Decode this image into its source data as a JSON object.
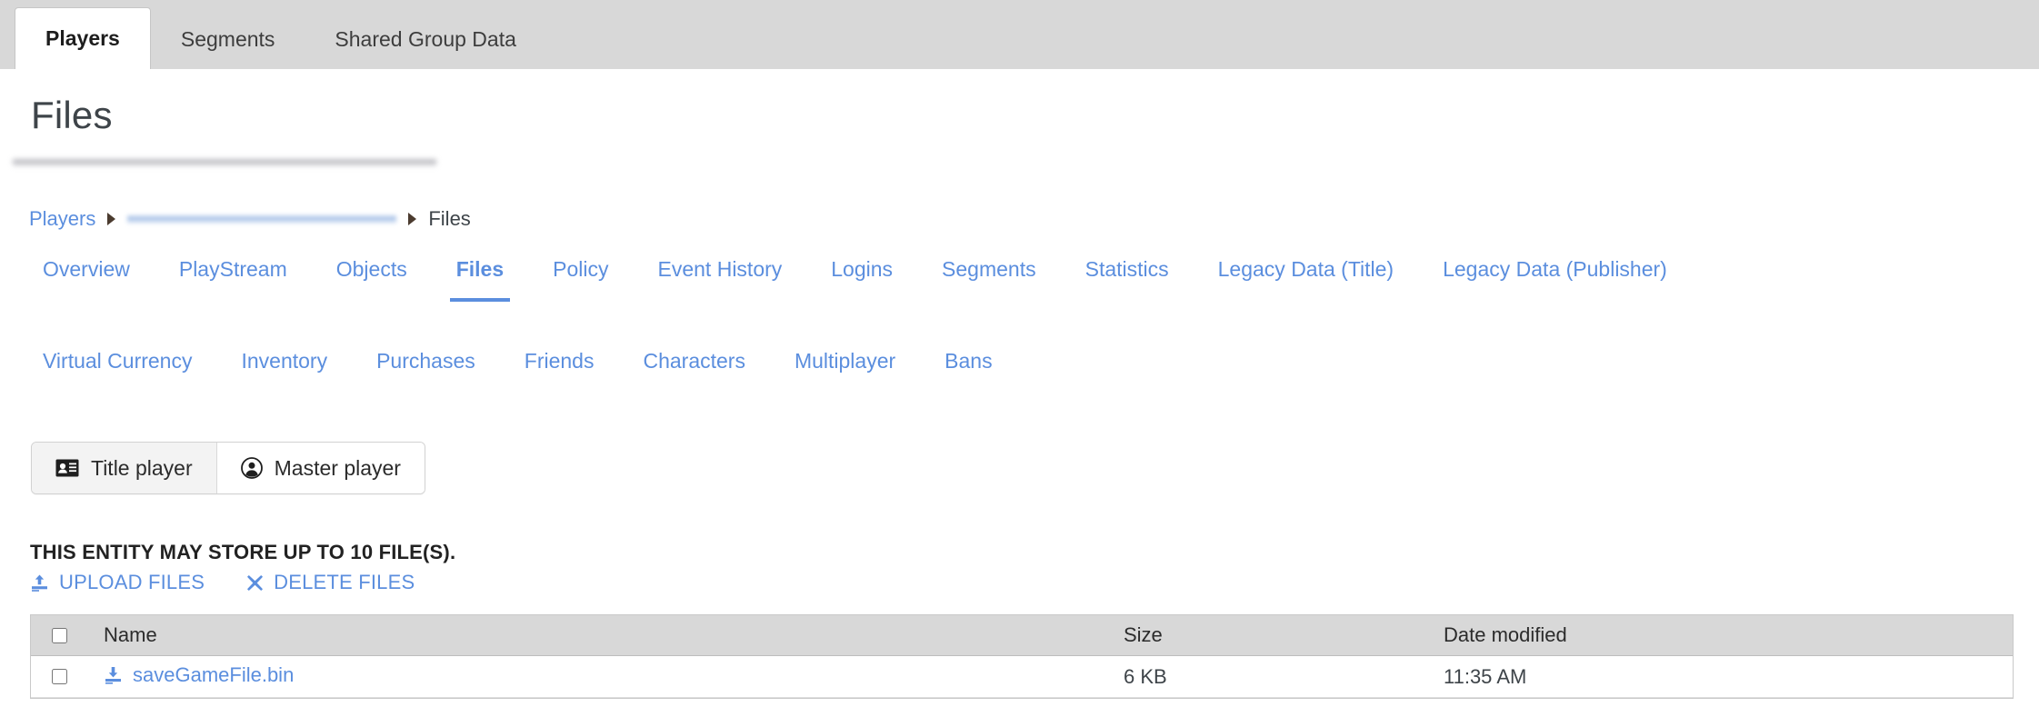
{
  "top_tabs": [
    {
      "label": "Players",
      "active": true
    },
    {
      "label": "Segments",
      "active": false
    },
    {
      "label": "Shared Group Data",
      "active": false
    }
  ],
  "page": {
    "title": "Files"
  },
  "breadcrumb": {
    "root": "Players",
    "middle_redacted": "",
    "current": "Files"
  },
  "section_nav": {
    "row1": [
      {
        "label": "Overview",
        "active": false
      },
      {
        "label": "PlayStream",
        "active": false
      },
      {
        "label": "Objects",
        "active": false
      },
      {
        "label": "Files",
        "active": true
      },
      {
        "label": "Policy",
        "active": false
      },
      {
        "label": "Event History",
        "active": false
      },
      {
        "label": "Logins",
        "active": false
      },
      {
        "label": "Segments",
        "active": false
      },
      {
        "label": "Statistics",
        "active": false
      },
      {
        "label": "Legacy Data (Title)",
        "active": false
      },
      {
        "label": "Legacy Data (Publisher)",
        "active": false
      }
    ],
    "row2": [
      {
        "label": "Virtual Currency",
        "active": false
      },
      {
        "label": "Inventory",
        "active": false
      },
      {
        "label": "Purchases",
        "active": false
      },
      {
        "label": "Friends",
        "active": false
      },
      {
        "label": "Characters",
        "active": false
      },
      {
        "label": "Multiplayer",
        "active": false
      },
      {
        "label": "Bans",
        "active": false
      }
    ]
  },
  "player_toggle": {
    "title_player": {
      "label": "Title player",
      "icon": "id-card-icon",
      "selected": true
    },
    "master_player": {
      "label": "Master player",
      "icon": "person-circle-icon",
      "selected": false
    }
  },
  "capacity_note": "THIS ENTITY MAY STORE UP TO 10 FILE(S).",
  "actions": {
    "upload": {
      "label": "UPLOAD FILES",
      "icon": "upload-icon"
    },
    "delete": {
      "label": "DELETE FILES",
      "icon": "close-x-icon"
    }
  },
  "files_table": {
    "columns": {
      "name": "Name",
      "size": "Size",
      "date_modified": "Date modified"
    },
    "rows": [
      {
        "name": "saveGameFile.bin",
        "size": "6 KB",
        "date_modified": "11:35 AM",
        "icon": "download-icon",
        "checked": false
      }
    ]
  },
  "colors": {
    "link_blue": "#5b8ede",
    "topbar_gray": "#d8d8d8",
    "table_header_gray": "#d8d8d8",
    "title_text": "#3e4449"
  }
}
